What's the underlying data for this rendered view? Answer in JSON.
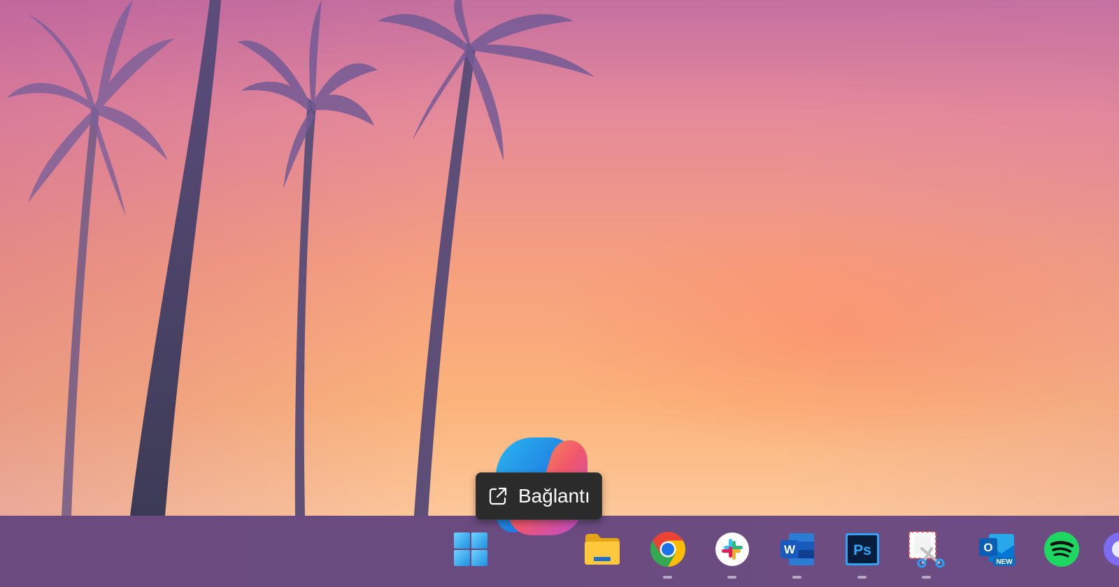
{
  "desktop": {
    "wallpaper": "palm-trees-sunset",
    "colors": {
      "sky_top": "#c46fa0",
      "sky_mid": "#f6a07e",
      "sky_bottom": "#fcc89a",
      "palm": "#5a4a7a"
    }
  },
  "tooltip": {
    "icon": "open-external-icon",
    "label": "Bağlantı"
  },
  "taskbar": {
    "background": "#6b4a7f",
    "items": [
      {
        "name": "start",
        "icon": "windows-logo-icon",
        "running": false
      },
      {
        "name": "copilot",
        "icon": "copilot-icon",
        "running": false
      },
      {
        "name": "file-explorer",
        "icon": "folder-icon",
        "running": false
      },
      {
        "name": "chrome",
        "icon": "chrome-icon",
        "running": true
      },
      {
        "name": "slack",
        "icon": "slack-icon",
        "running": true
      },
      {
        "name": "word",
        "icon": "word-icon",
        "letter": "W",
        "running": true
      },
      {
        "name": "photoshop",
        "icon": "photoshop-icon",
        "letter": "Ps",
        "running": true
      },
      {
        "name": "snipping-tool",
        "icon": "snipping-tool-icon",
        "running": true
      },
      {
        "name": "outlook-new",
        "icon": "outlook-icon",
        "letter": "O",
        "badge": "NEW",
        "running": false
      },
      {
        "name": "spotify",
        "icon": "spotify-icon",
        "running": false
      },
      {
        "name": "partial-app",
        "icon": "app-icon",
        "running": false
      }
    ]
  }
}
